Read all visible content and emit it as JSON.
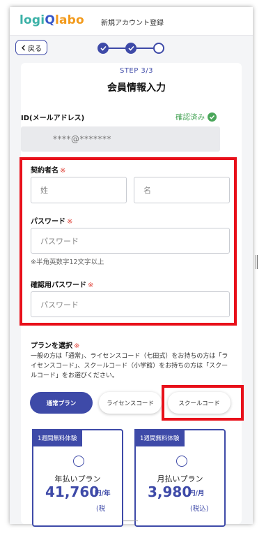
{
  "header": {
    "logo_part1": "logi",
    "logo_part2": "Q",
    "logo_part3": "labo",
    "title": "新規アカウント登録"
  },
  "nav": {
    "back_label": "戻る",
    "step_progress": {
      "current": 3,
      "total": 3
    }
  },
  "form": {
    "step_label": "STEP 3/3",
    "title": "会員情報入力",
    "email": {
      "label": "ID(メールアドレス)",
      "status": "確認済み",
      "value": "****@*******"
    },
    "name": {
      "label": "契約者名",
      "required_mark": "※",
      "last_placeholder": "姓",
      "first_placeholder": "名"
    },
    "password": {
      "label": "パスワード",
      "required_mark": "※",
      "placeholder": "パスワード",
      "hint": "※半角英数字12文字以上"
    },
    "password_confirm": {
      "label": "確認用パスワード",
      "required_mark": "※",
      "placeholder": "パスワード"
    }
  },
  "plans": {
    "label": "プランを選択",
    "required_mark": "※",
    "description": "一般の方は「通常」、ライセンスコード（七田式）をお持ちの方は「ライセンスコード」、スクールコード（小学館）をお持ちの方は「スクールコード」をお選びください。",
    "tabs": [
      {
        "label": "通常プラン",
        "selected": true
      },
      {
        "label": "ライセンスコード",
        "selected": false
      },
      {
        "label": "スクールコード",
        "selected": false
      }
    ],
    "cards": [
      {
        "tag": "1週間無料体験",
        "name": "年払いプラン",
        "price": "41,760",
        "unit": "円/年",
        "tax": "(税"
      },
      {
        "tag": "1週間無料体験",
        "name": "月払いプラン",
        "price": "3,980",
        "unit": "円/月",
        "tax": "(税込)"
      }
    ]
  },
  "colors": {
    "primary": "#3e4aa8",
    "verified": "#4aa65a",
    "required": "#e0463c",
    "highlight_box": "#e8101a"
  }
}
